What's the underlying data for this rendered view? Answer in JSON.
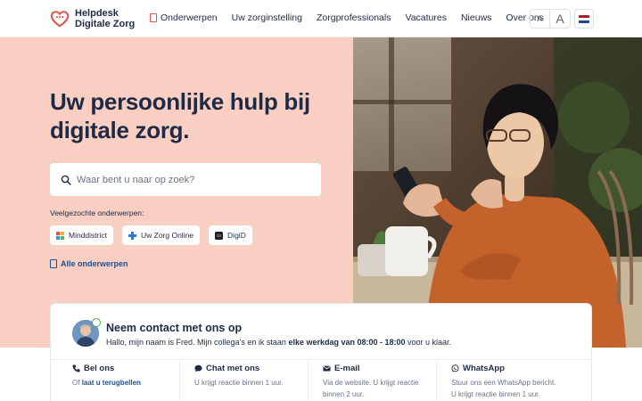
{
  "brand": {
    "line1": "Helpdesk",
    "line2": "Digitale Zorg"
  },
  "nav": [
    {
      "label": "Onderwerpen"
    },
    {
      "label": "Uw zorginstelling"
    },
    {
      "label": "Zorgprofessionals"
    },
    {
      "label": "Vacatures"
    },
    {
      "label": "Nieuws"
    },
    {
      "label": "Over ons"
    }
  ],
  "tools": {
    "font_small": "A",
    "font_large": "A",
    "language_flag": "flag-nl-icon"
  },
  "hero": {
    "title": "Uw persoonlijke hulp bij digitale zorg.",
    "search_placeholder": "Waar bent u naar op zoek?",
    "popular_label": "Veelgezochte onderwerpen:",
    "chips": [
      {
        "label": "Minddistrict",
        "icon": "minddistrict-icon"
      },
      {
        "label": "Uw Zorg Online",
        "icon": "plus-cross-icon"
      },
      {
        "label": "DigiD",
        "icon": "digid-icon"
      }
    ],
    "all_topics": "Alle onderwerpen"
  },
  "contact": {
    "title": "Neem contact met ons op",
    "intro_start": "Hallo, mijn naam is Fred. Mijn collega’s en ik staan",
    "intro_bold": "elke werkdag van 08:00 - 18:00",
    "intro_end": "voor u klaar.",
    "channels": [
      {
        "title": "Bel ons",
        "icon": "phone-icon",
        "desc_prefix": "Of",
        "desc_link": "laat u terugbellen"
      },
      {
        "title": "Chat met ons",
        "icon": "chat-icon",
        "desc": "U krijgt reactie binnen 1 uur."
      },
      {
        "title": "E-mail",
        "icon": "mail-icon",
        "desc": "Via de website. U krijgt reactie binnen 2 uur."
      },
      {
        "title": "WhatsApp",
        "icon": "whatsapp-icon",
        "desc": "Stuur ons een WhatsApp bericht. U krijgt reactie binnen 1 uur."
      }
    ]
  },
  "colors": {
    "hero_bg": "#f9cfc4",
    "brand_red": "#e2574c",
    "navy": "#1f2a44",
    "link_blue": "#1d4f91"
  }
}
